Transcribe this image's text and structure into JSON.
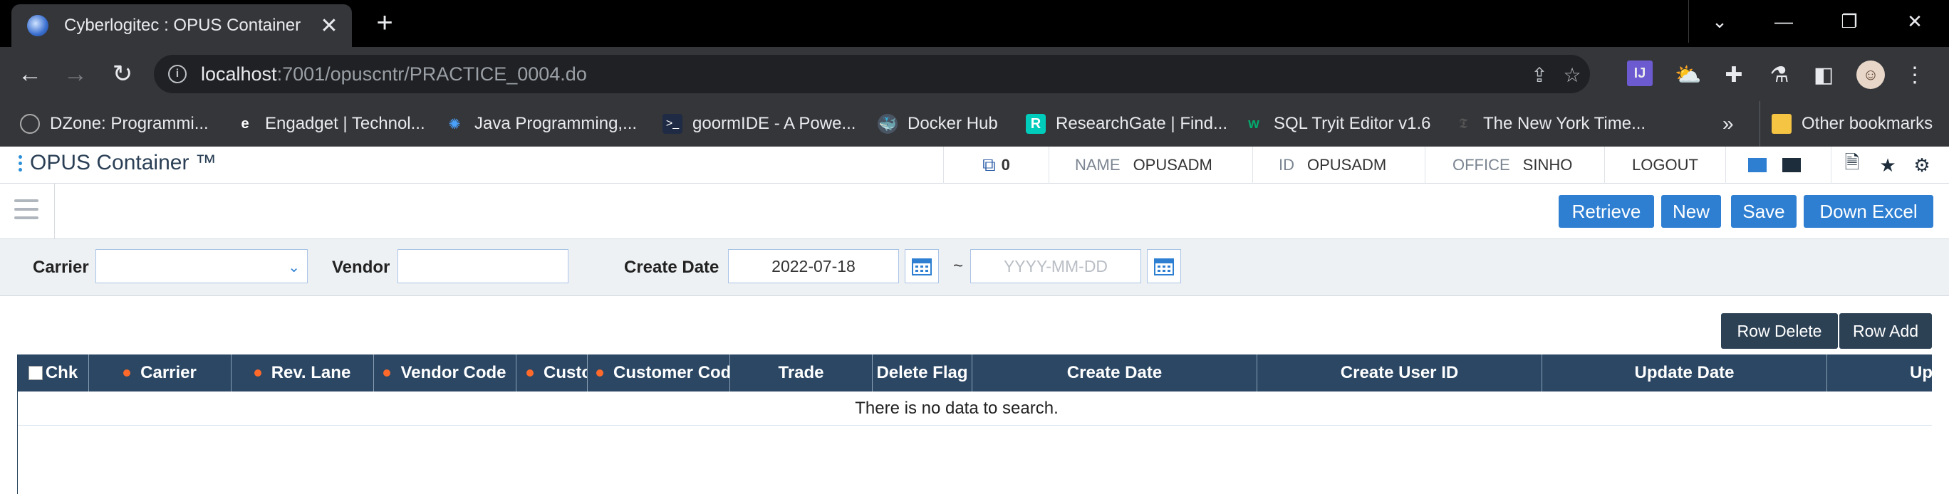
{
  "browser": {
    "tab_title": "Cyberlogitec : OPUS Container",
    "url_host": "localhost",
    "url_rest": ":7001/opuscntr/PRACTICE_0004.do",
    "bookmarks": [
      "DZone: Programmi...",
      "Engadget | Technol...",
      "Java Programming,...",
      "goormIDE - A Powe...",
      "Docker Hub",
      "ResearchGate | Find...",
      "SQL Tryit Editor v1.6",
      "The New York Time..."
    ],
    "bookmarks_more": "»",
    "other_bookmarks": "Other bookmarks"
  },
  "app": {
    "logo": "OPUS Container ™",
    "notifications": "0",
    "name_key": "NAME",
    "name_val": "OPUSADM",
    "id_key": "ID",
    "id_val": "OPUSADM",
    "office_key": "OFFICE",
    "office_val": "SINHO",
    "logout": "LOGOUT"
  },
  "toolbar": {
    "retrieve": "Retrieve",
    "new": "New",
    "save": "Save",
    "down_excel": "Down Excel"
  },
  "search": {
    "carrier_label": "Carrier",
    "carrier_value": "",
    "vendor_label": "Vendor",
    "vendor_value": "",
    "create_date_label": "Create Date",
    "date_from": "2022-07-18",
    "date_sep": "~",
    "date_to_placeholder": "YYYY-MM-DD"
  },
  "grid": {
    "row_delete": "Row Delete",
    "row_add": "Row Add",
    "columns": [
      {
        "label": "Chk",
        "required": false
      },
      {
        "label": "Carrier",
        "required": true
      },
      {
        "label": "Rev. Lane",
        "required": true
      },
      {
        "label": "Vendor Code",
        "required": true
      },
      {
        "label": "Custo",
        "required": true
      },
      {
        "label": "Customer Cod",
        "required": true
      },
      {
        "label": "Trade",
        "required": false
      },
      {
        "label": "Delete Flag",
        "required": false
      },
      {
        "label": "Create Date",
        "required": false
      },
      {
        "label": "Create User ID",
        "required": false
      },
      {
        "label": "Update Date",
        "required": false
      },
      {
        "label": "Up",
        "required": false
      }
    ],
    "empty_message": "There is no data to search."
  },
  "colors": {
    "primary_button": "#2e7fd2",
    "dark_button": "#2d4155",
    "grid_header": "#2b4764",
    "required_dot": "#ff6a2b"
  }
}
